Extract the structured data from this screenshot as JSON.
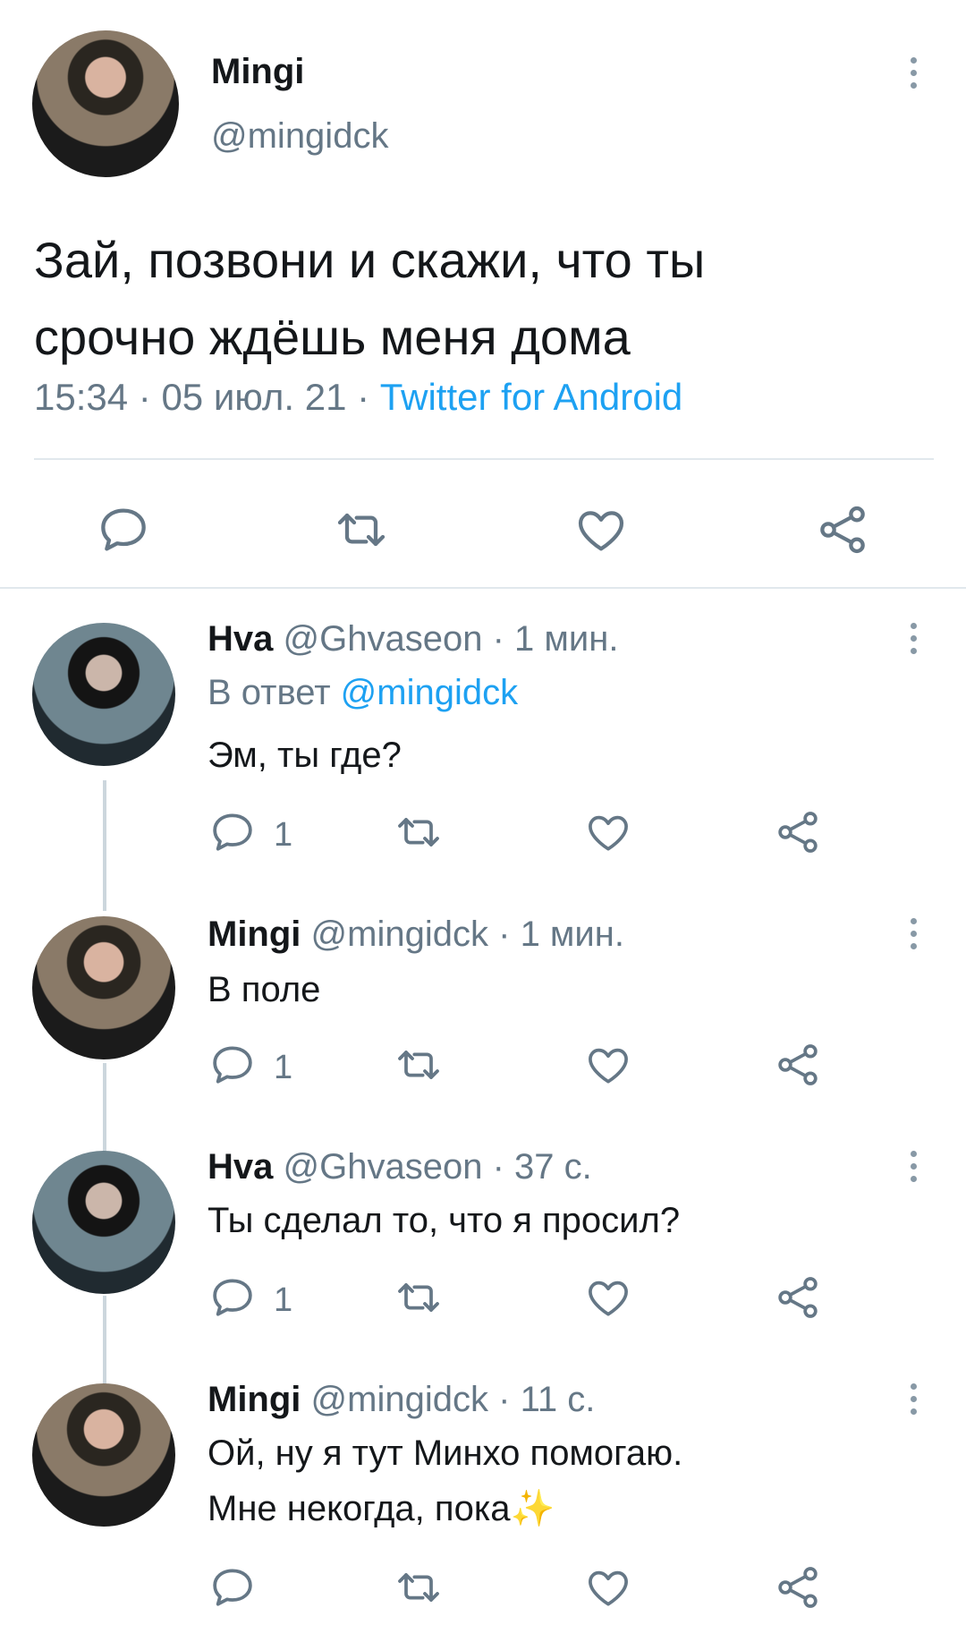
{
  "main_tweet": {
    "author_name": "Mingi",
    "handle": "@mingidck",
    "text_line1": "Зай, позвони и скажи, что ты",
    "text_line2": "срочно ждёшь меня дома",
    "time": "15:34",
    "date": "05 июл. 21",
    "source": "Twitter for Android",
    "dot": "·"
  },
  "replies": [
    {
      "name": "Hva",
      "handle": "@Ghvaseon",
      "time": "1 мин.",
      "reply_to_label": "В ответ",
      "reply_to": "@mingidck",
      "text_line1": "Эм, ты где?",
      "reply_count": "1"
    },
    {
      "name": "Mingi",
      "handle": "@mingidck",
      "time": "1 мин.",
      "text_line1": "В поле",
      "reply_count": "1"
    },
    {
      "name": "Hva",
      "handle": "@Ghvaseon",
      "time": "37 с.",
      "text_line1": "Ты сделал то, что я просил?",
      "reply_count": "1"
    },
    {
      "name": "Mingi",
      "handle": "@mingidck",
      "time": "11 с.",
      "text_line1": "Ой, ну я тут Минхо помогаю.",
      "text_line2": "Мне некогда, пока",
      "emoji": "✨"
    }
  ],
  "colors": {
    "text": "#14171a",
    "muted": "#657786",
    "link": "#1da1f2",
    "divider": "#e1e8ed",
    "icon": "#657786",
    "sparkle": "#f5c518"
  },
  "icons": [
    "more-icon",
    "reply-icon",
    "retweet-icon",
    "like-icon",
    "share-icon"
  ]
}
